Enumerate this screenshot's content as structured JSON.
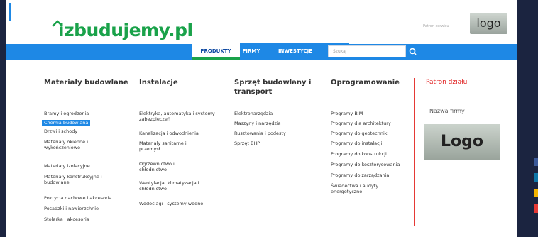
{
  "header": {
    "logo": "izbudujemy.pl",
    "sponsor_text": "Patron serwisu",
    "logo_badge": "logo"
  },
  "nav": {
    "tabs": [
      "PRODUKTY",
      "FIRMY",
      "INWESTYCJE"
    ],
    "active_tab": "PRODUKTY",
    "search_placeholder": "Szukaj"
  },
  "menu": {
    "columns": [
      {
        "heading": "Materiały budowlane",
        "items": [
          "Bramy i ogrodzenia",
          "Chemia budowlana",
          "Drzwi i schody",
          "Materiały okienne i wykończeniowe",
          "Materiały izolacyjne",
          "Materiały konstrukcyjne i budowlane",
          "Pokrycia dachowe i akcesoria",
          "Posadzki i nawierzchnie",
          "Stolarka i akcesoria"
        ]
      },
      {
        "heading": "Instalacje",
        "items": [
          "Elektryka, automatyka i systemy zabezpieczeń",
          "Kanalizacja i odwodnienia",
          "Materiały sanitarne i przemysł",
          "Ogrzewnictwo i chłodnictwo",
          "Wentylacja, klimatyzacja i chłodnictwo",
          "Wodociągi i systemy wodne"
        ]
      },
      {
        "heading": "Sprzęt budowlany i transport",
        "items": [
          "Elektronarzędzia",
          "Maszyny i narzędzia",
          "Rusztowania i podesty",
          "Sprzęt BHP"
        ]
      },
      {
        "heading": "Oprogramowanie",
        "items": [
          "Programy BIM",
          "Programy dla architektury",
          "Programy do geotechniki",
          "Programy do instalacji",
          "Programy do konstrukcji",
          "Programy do kosztorysowania",
          "Programy do zarządzania",
          "Świadectwa i audyty energetyczne"
        ]
      }
    ],
    "patron": {
      "heading": "Patron działu",
      "subheading": "Nazwa firmy",
      "logo": "Logo"
    }
  },
  "colors": {
    "accent_blue": "#1e88e5",
    "brand_green": "#1aa24a",
    "patron_red": "#e02020",
    "dark_side": "#1b2440"
  }
}
